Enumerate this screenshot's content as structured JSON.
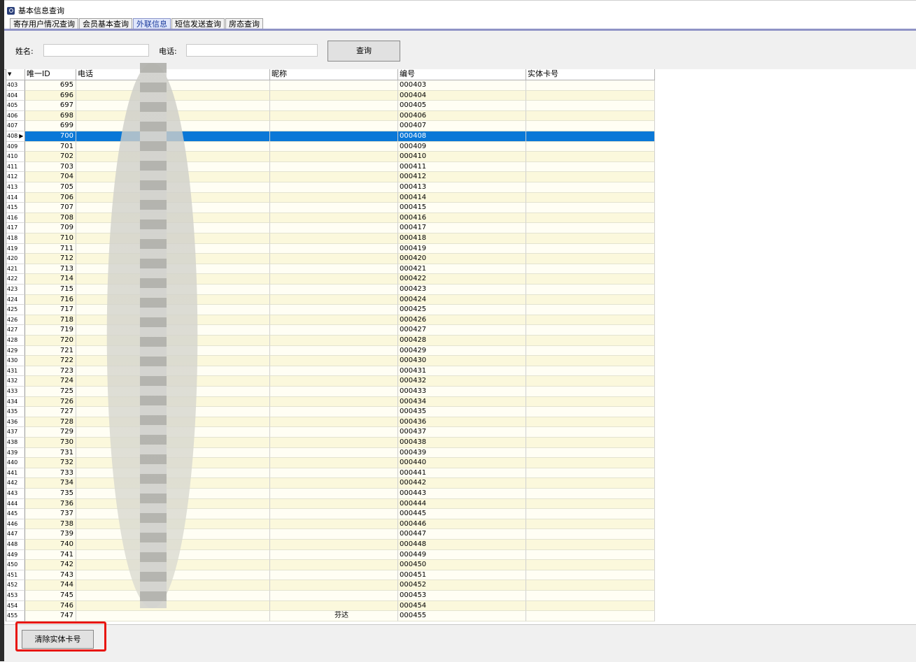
{
  "window": {
    "title": "基本信息查询",
    "title_icon": "search-icon"
  },
  "tabs": [
    {
      "label": "寄存用户情况查询",
      "active": false
    },
    {
      "label": "会员基本查询",
      "active": false
    },
    {
      "label": "外联信息",
      "active": true
    },
    {
      "label": "短信发送查询",
      "active": false
    },
    {
      "label": "房态查询",
      "active": false
    }
  ],
  "search": {
    "name_label": "姓名:",
    "name_value": "",
    "phone_label": "电话:",
    "phone_value": "",
    "query_button": "查询"
  },
  "grid": {
    "columns": [
      "唯一ID",
      "电话",
      "昵称",
      "编号",
      "实体卡号"
    ],
    "selected_row_number": "408",
    "rows": [
      {
        "n": "403",
        "id": "695",
        "no": "000403"
      },
      {
        "n": "404",
        "id": "696",
        "no": "000404"
      },
      {
        "n": "405",
        "id": "697",
        "no": "000405"
      },
      {
        "n": "406",
        "id": "698",
        "no": "000406"
      },
      {
        "n": "407",
        "id": "699",
        "no": "000407"
      },
      {
        "n": "408",
        "id": "700",
        "no": "000408"
      },
      {
        "n": "409",
        "id": "701",
        "no": "000409"
      },
      {
        "n": "410",
        "id": "702",
        "no": "000410"
      },
      {
        "n": "411",
        "id": "703",
        "no": "000411"
      },
      {
        "n": "412",
        "id": "704",
        "no": "000412"
      },
      {
        "n": "413",
        "id": "705",
        "no": "000413"
      },
      {
        "n": "414",
        "id": "706",
        "no": "000414"
      },
      {
        "n": "415",
        "id": "707",
        "no": "000415"
      },
      {
        "n": "416",
        "id": "708",
        "no": "000416"
      },
      {
        "n": "417",
        "id": "709",
        "no": "000417"
      },
      {
        "n": "418",
        "id": "710",
        "no": "000418"
      },
      {
        "n": "419",
        "id": "711",
        "no": "000419"
      },
      {
        "n": "420",
        "id": "712",
        "no": "000420"
      },
      {
        "n": "421",
        "id": "713",
        "no": "000421"
      },
      {
        "n": "422",
        "id": "714",
        "no": "000422"
      },
      {
        "n": "423",
        "id": "715",
        "no": "000423"
      },
      {
        "n": "424",
        "id": "716",
        "no": "000424"
      },
      {
        "n": "425",
        "id": "717",
        "no": "000425"
      },
      {
        "n": "426",
        "id": "718",
        "no": "000426"
      },
      {
        "n": "427",
        "id": "719",
        "no": "000427"
      },
      {
        "n": "428",
        "id": "720",
        "no": "000428"
      },
      {
        "n": "429",
        "id": "721",
        "no": "000429"
      },
      {
        "n": "430",
        "id": "722",
        "no": "000430"
      },
      {
        "n": "431",
        "id": "723",
        "no": "000431"
      },
      {
        "n": "432",
        "id": "724",
        "no": "000432"
      },
      {
        "n": "433",
        "id": "725",
        "no": "000433"
      },
      {
        "n": "434",
        "id": "726",
        "no": "000434"
      },
      {
        "n": "435",
        "id": "727",
        "no": "000435"
      },
      {
        "n": "436",
        "id": "728",
        "no": "000436"
      },
      {
        "n": "437",
        "id": "729",
        "no": "000437"
      },
      {
        "n": "438",
        "id": "730",
        "no": "000438"
      },
      {
        "n": "439",
        "id": "731",
        "no": "000439"
      },
      {
        "n": "440",
        "id": "732",
        "no": "000440"
      },
      {
        "n": "441",
        "id": "733",
        "no": "000441"
      },
      {
        "n": "442",
        "id": "734",
        "no": "000442"
      },
      {
        "n": "443",
        "id": "735",
        "no": "000443"
      },
      {
        "n": "444",
        "id": "736",
        "no": "000444"
      },
      {
        "n": "445",
        "id": "737",
        "no": "000445"
      },
      {
        "n": "446",
        "id": "738",
        "no": "000446"
      },
      {
        "n": "447",
        "id": "739",
        "no": "000447"
      },
      {
        "n": "448",
        "id": "740",
        "no": "000448"
      },
      {
        "n": "449",
        "id": "741",
        "no": "000449"
      },
      {
        "n": "450",
        "id": "742",
        "no": "000450"
      },
      {
        "n": "451",
        "id": "743",
        "no": "000451"
      },
      {
        "n": "452",
        "id": "744",
        "no": "000452"
      },
      {
        "n": "453",
        "id": "745",
        "no": "000453"
      },
      {
        "n": "454",
        "id": "746",
        "no": "000454"
      },
      {
        "n": "455",
        "id": "747",
        "no": "000455",
        "nick": "芬达"
      }
    ]
  },
  "footer": {
    "clear_button": "清除实体卡号",
    "highlight_color": "#e8160f"
  },
  "colors": {
    "selection": "#0a78d7",
    "row_alt": "#fbf8dc",
    "tab_accent": "#8f93c6"
  }
}
